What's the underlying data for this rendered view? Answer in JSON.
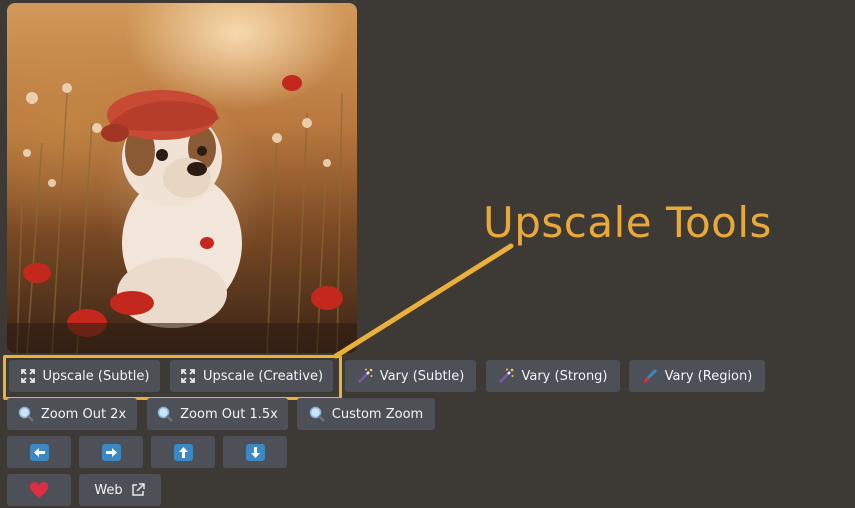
{
  "callout": {
    "label": "Upscale Tools",
    "color": "#e8a93a"
  },
  "row1": [
    {
      "label": "Upscale (Subtle)",
      "icon": "expand-icon"
    },
    {
      "label": "Upscale (Creative)",
      "icon": "expand-icon"
    },
    {
      "label": "Vary (Subtle)",
      "icon": "magic-wand-icon"
    },
    {
      "label": "Vary (Strong)",
      "icon": "magic-wand-icon"
    },
    {
      "label": "Vary (Region)",
      "icon": "paintbrush-icon"
    }
  ],
  "row2": [
    {
      "label": "Zoom Out 2x",
      "icon": "magnifier-icon"
    },
    {
      "label": "Zoom Out 1.5x",
      "icon": "magnifier-icon"
    },
    {
      "label": "Custom Zoom",
      "icon": "magnifier-icon"
    }
  ],
  "row3": [
    {
      "icon": "arrow-left-icon"
    },
    {
      "icon": "arrow-right-icon"
    },
    {
      "icon": "arrow-up-icon"
    },
    {
      "icon": "arrow-down-icon"
    }
  ],
  "row4": [
    {
      "icon": "heart-icon"
    },
    {
      "label": "Web",
      "icon": "external-link-icon"
    }
  ],
  "colors": {
    "background": "#3d3935",
    "button": "#4e5058",
    "highlight": "#eab03c",
    "arrow_box": "#3b88c3",
    "heart": "#dd2e44"
  }
}
